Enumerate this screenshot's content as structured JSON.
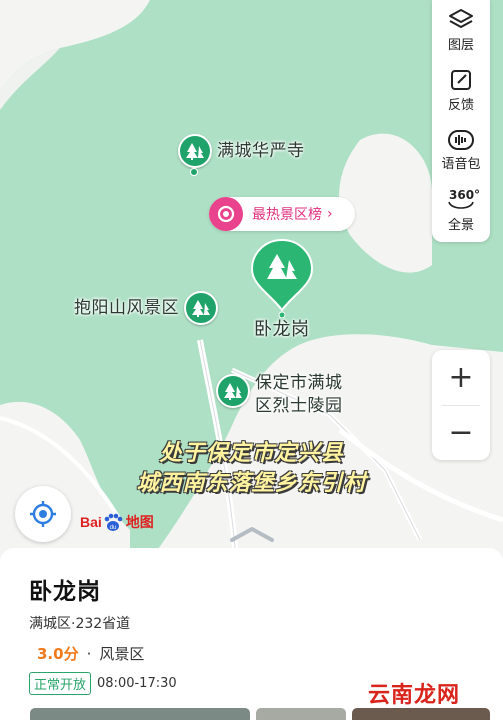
{
  "map": {
    "pois": [
      {
        "id": "huayan",
        "label": "满城华严寺"
      },
      {
        "id": "baoyang",
        "label": "抱阳山风景区"
      },
      {
        "id": "lieshi_1",
        "label": "保定市满城"
      },
      {
        "id": "lieshi_2",
        "label": "区烈士陵园"
      }
    ],
    "main_pin_label": "卧龙岗",
    "hot_ranking_label": "最热景区榜",
    "hot_ranking_chevron": "›",
    "subtitle_line1": "处于保定市定兴县",
    "subtitle_line2": "城西南东落堡乡东引村",
    "logo_text_1": "Bai",
    "logo_text_2": "地图",
    "colors": {
      "map_green": "#aee0c5",
      "poi_green": "#1fa36a",
      "hot_pink": "#e8438c",
      "rating_orange": "#f07a1a",
      "open_green": "#2aa56a",
      "watermark_red": "#d9241c"
    }
  },
  "tools": [
    {
      "icon": "layers-icon",
      "label": "图层"
    },
    {
      "icon": "feedback-icon",
      "label": "反馈"
    },
    {
      "icon": "voice-pack-icon",
      "label": "语音包"
    },
    {
      "icon": "panorama-icon",
      "label": "全景",
      "badge": "360°"
    }
  ],
  "zoom": {
    "in": "+",
    "out": "−"
  },
  "place": {
    "title": "卧龙岗",
    "address": "满城区·232省道",
    "rating": "3.0分",
    "dot": "·",
    "category": "风景区",
    "open_status": "正常开放",
    "hours": "08:00-17:30"
  },
  "watermark": "云南龙网"
}
